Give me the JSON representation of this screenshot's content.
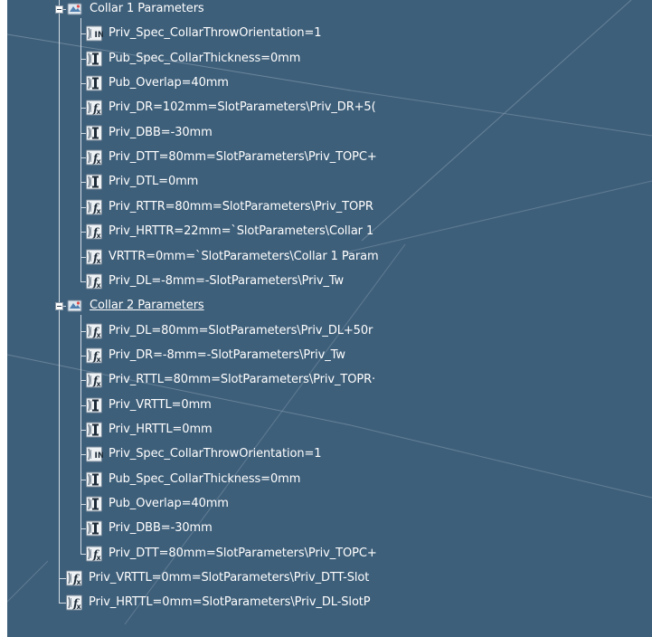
{
  "tree": {
    "groups": [
      {
        "label": "Collar 1 Parameters",
        "icon": "parameter-set-icon",
        "underlined": false,
        "params": [
          {
            "text": "Priv_Spec_CollarThrowOrientation=1",
            "icon": "integer-parameter-icon"
          },
          {
            "text": "Pub_Spec_CollarThickness=0mm",
            "icon": "length-parameter-icon"
          },
          {
            "text": "Pub_Overlap=40mm",
            "icon": "length-parameter-icon"
          },
          {
            "text": "Priv_DR=102mm=SlotParameters\\Priv_DR+5(",
            "icon": "formula-parameter-icon"
          },
          {
            "text": "Priv_DBB=-30mm",
            "icon": "length-parameter-icon"
          },
          {
            "text": "Priv_DTT=80mm=SlotParameters\\Priv_TOPC+",
            "icon": "formula-parameter-icon"
          },
          {
            "text": "Priv_DTL=0mm",
            "icon": "length-parameter-icon"
          },
          {
            "text": "Priv_RTTR=80mm=SlotParameters\\Priv_TOPR",
            "icon": "formula-parameter-icon"
          },
          {
            "text": "Priv_HRTTR=22mm=`SlotParameters\\Collar 1",
            "icon": "formula-parameter-icon"
          },
          {
            "text": "VRTTR=0mm=`SlotParameters\\Collar 1 Param",
            "icon": "formula-parameter-icon"
          },
          {
            "text": "Priv_DL=-8mm=-SlotParameters\\Priv_Tw",
            "icon": "formula-parameter-icon"
          }
        ]
      },
      {
        "label": "Collar 2 Parameters",
        "icon": "parameter-set-icon",
        "underlined": true,
        "params": [
          {
            "text": "Priv_DL=80mm=SlotParameters\\Priv_DL+50r",
            "icon": "formula-parameter-icon"
          },
          {
            "text": "Priv_DR=-8mm=-SlotParameters\\Priv_Tw",
            "icon": "formula-parameter-icon"
          },
          {
            "text": "Priv_RTTL=80mm=SlotParameters\\Priv_TOPR·",
            "icon": "formula-parameter-icon"
          },
          {
            "text": "Priv_VRTTL=0mm",
            "icon": "length-parameter-icon"
          },
          {
            "text": "Priv_HRTTL=0mm",
            "icon": "length-parameter-icon"
          },
          {
            "text": "Priv_Spec_CollarThrowOrientation=1",
            "icon": "integer-parameter-icon"
          },
          {
            "text": "Pub_Spec_CollarThickness=0mm",
            "icon": "length-parameter-icon"
          },
          {
            "text": "Pub_Overlap=40mm",
            "icon": "length-parameter-icon"
          },
          {
            "text": "Priv_DBB=-30mm",
            "icon": "length-parameter-icon"
          },
          {
            "text": "Priv_DTT=80mm=SlotParameters\\Priv_TOPC+",
            "icon": "formula-parameter-icon"
          }
        ]
      }
    ],
    "root_params": [
      {
        "text": "Priv_VRTTL=0mm=SlotParameters\\Priv_DTT-Slot",
        "icon": "formula-parameter-icon"
      },
      {
        "text": "Priv_HRTTL=0mm=SlotParameters\\Priv_DL-SlotP",
        "icon": "formula-parameter-icon"
      }
    ]
  },
  "colors": {
    "background": "#3e5f7a",
    "text": "#ffffff",
    "tree_line": "#d4dde6"
  }
}
